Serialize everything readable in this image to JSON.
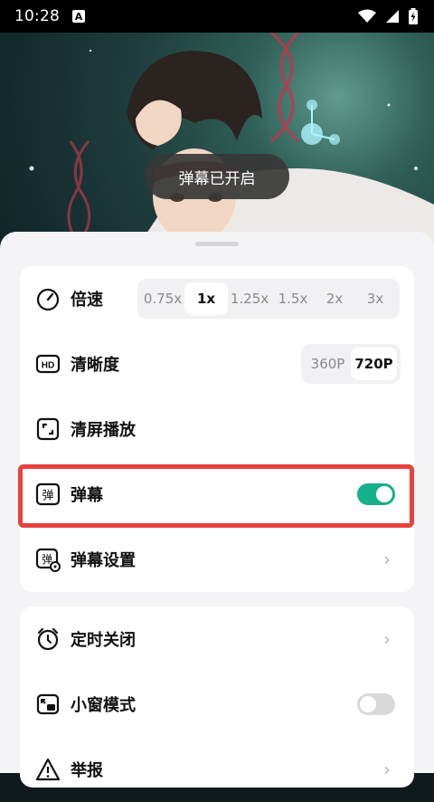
{
  "status_bar": {
    "time": "10:28",
    "notification_badge": "A",
    "icons": [
      "wifi-icon",
      "signal-icon",
      "battery-charging-icon"
    ]
  },
  "video": {
    "toast": "弹幕已开启"
  },
  "settings": {
    "speed": {
      "label": "倍速",
      "options": [
        "0.75x",
        "1x",
        "1.25x",
        "1.5x",
        "2x",
        "3x"
      ],
      "selected": "1x"
    },
    "quality": {
      "label": "清晰度",
      "options": [
        "360P",
        "720P"
      ],
      "selected": "720P"
    },
    "clear_screen": {
      "label": "清屏播放"
    },
    "danmaku": {
      "label": "弹幕",
      "enabled": true
    },
    "danmaku_settings": {
      "label": "弹幕设置"
    },
    "timer_close": {
      "label": "定时关闭"
    },
    "mini_window": {
      "label": "小窗模式",
      "enabled": false
    },
    "report": {
      "label": "举报"
    }
  },
  "colors": {
    "accent": "#16b08a",
    "toggle_off": "#d9d9dc",
    "highlight": "#e84141"
  }
}
